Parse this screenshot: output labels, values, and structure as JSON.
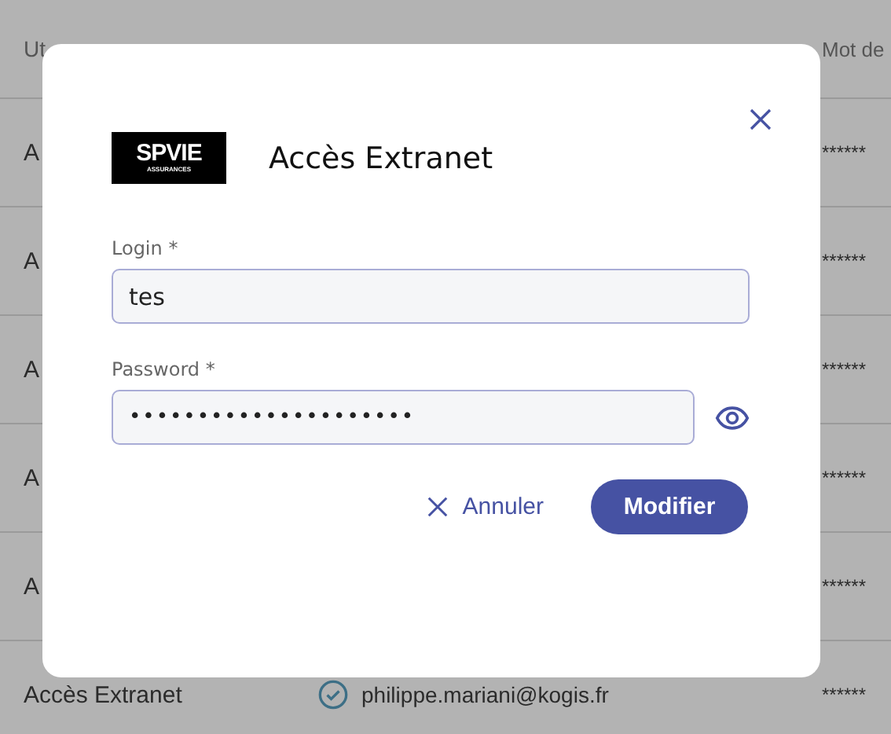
{
  "table": {
    "columns": [
      "Ut",
      "Mot de"
    ],
    "rows": [
      {
        "column_1": "A",
        "column_3": "******"
      },
      {
        "column_1": "A",
        "column_3": "******"
      },
      {
        "column_1": "A",
        "column_3": "******"
      },
      {
        "column_1": "A",
        "column_3": "******"
      },
      {
        "column_1": "A",
        "column_3": "******"
      },
      {
        "column_1": "Accès Extranet",
        "column_2": "philippe.mariani@kogis.fr",
        "column_3": "******"
      }
    ]
  },
  "dialog": {
    "logo": {
      "name": "SPVIE",
      "tagline": "ASSURANCES"
    },
    "title": "Accès Extranet",
    "fields": [
      {
        "label": "Login *",
        "value": "tes",
        "kind": "text"
      },
      {
        "label": "Password *",
        "value": "•••••••••••••••••••••",
        "kind": "password"
      }
    ],
    "buttons": [
      {
        "label": "Annuler",
        "kind": "cancel"
      },
      {
        "label": "Modifier",
        "kind": "primary"
      }
    ]
  }
}
